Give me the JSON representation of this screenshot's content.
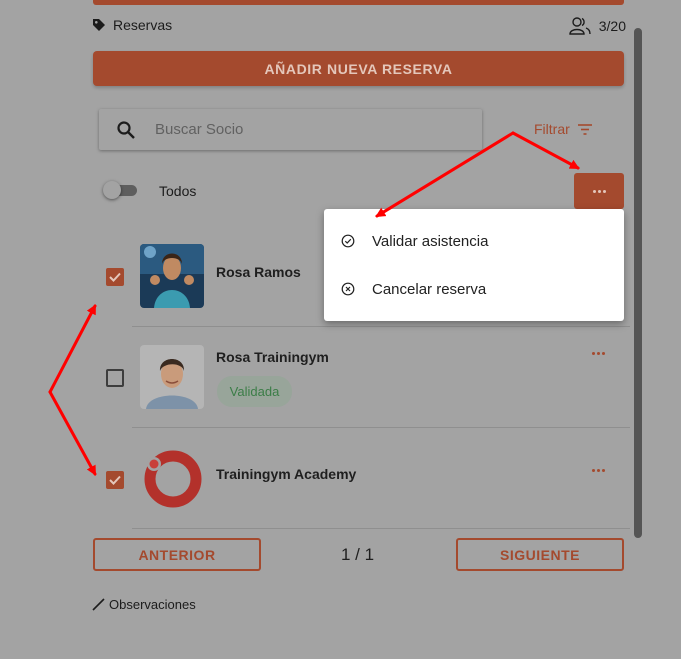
{
  "header": {
    "reservas_label": "Reservas",
    "count": "3/20",
    "add_button": "AÑADIR NUEVA RESERVA"
  },
  "search": {
    "placeholder": "Buscar Socio"
  },
  "filter": {
    "label": "Filtrar"
  },
  "toggle": {
    "label": "Todos",
    "on": false
  },
  "menu": {
    "items": [
      {
        "label": "Validar asistencia",
        "icon": "check-circle-icon"
      },
      {
        "label": "Cancelar reserva",
        "icon": "x-circle-icon"
      }
    ]
  },
  "members": [
    {
      "name": "Rosa Ramos",
      "checked": true,
      "badge": ""
    },
    {
      "name": "Rosa Trainingym",
      "checked": false,
      "badge": "Validada"
    },
    {
      "name": "Trainingym Academy",
      "checked": true,
      "badge": ""
    }
  ],
  "pager": {
    "prev": "ANTERIOR",
    "next": "SIGUIENTE",
    "page": "1 / 1"
  },
  "footer": {
    "observaciones": "Observaciones"
  },
  "colors": {
    "accent": "#a44a2e",
    "validated_text": "#3b7d47",
    "annotation_arrow": "#ff0000"
  }
}
